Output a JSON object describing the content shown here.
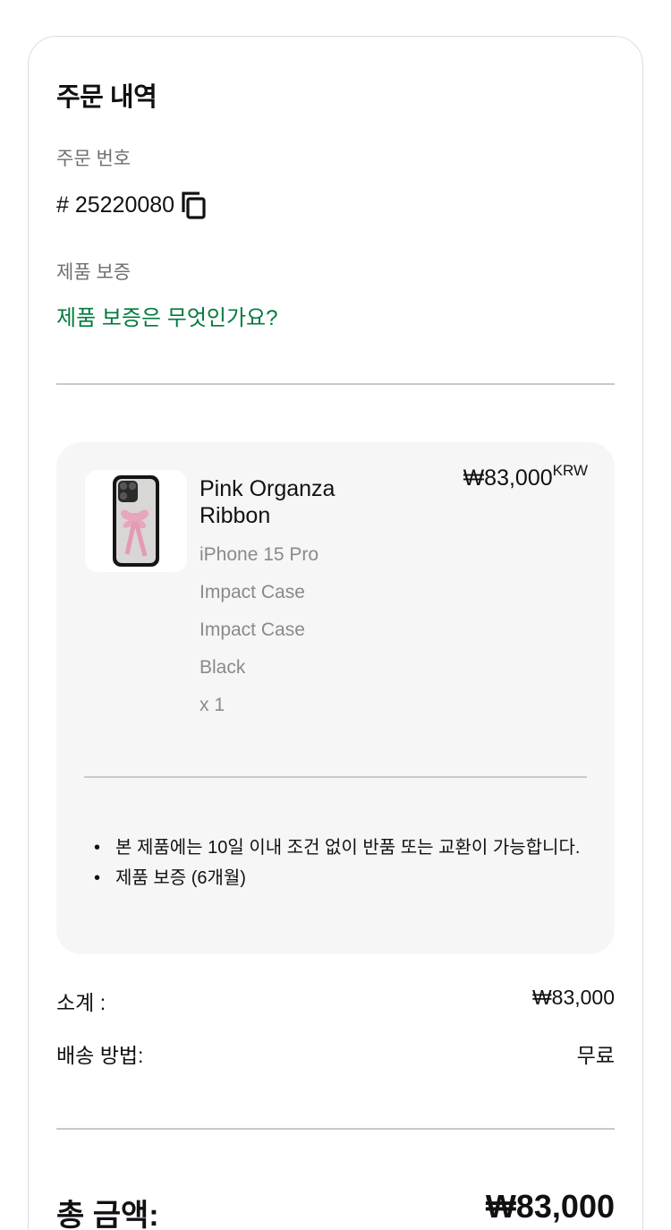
{
  "order": {
    "title": "주문 내역",
    "number_label": "주문 번호",
    "number": "# 25220080",
    "copy_icon": "copy-icon"
  },
  "warranty": {
    "label": "제품 보증",
    "link_text": "제품 보증은 무엇인가요?",
    "link_color": "#007a3d"
  },
  "product": {
    "name": "Pink Organza Ribbon",
    "price": "₩83,000",
    "currency": "KRW",
    "attributes": [
      "iPhone 15 Pro",
      "Impact Case",
      "Impact Case",
      "Black",
      "x 1"
    ],
    "notes": [
      "본 제품에는 10일 이내 조건 없이 반품 또는 교환이 가능합니다.",
      "제품 보증 (6개월)"
    ]
  },
  "summary": {
    "subtotal_label": "소계 :",
    "subtotal_value": "₩83,000",
    "shipping_label": "배송 방법:",
    "shipping_value": "무료",
    "total_label": "총 금액:",
    "total_value": "₩83,000"
  }
}
